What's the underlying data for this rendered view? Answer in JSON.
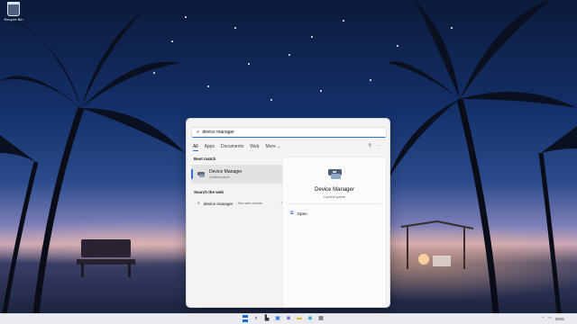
{
  "desktop": {
    "icons": [
      {
        "name": "recycle-bin",
        "label": "Recycle Bin"
      }
    ]
  },
  "search": {
    "query": "device manager",
    "filters": [
      "All",
      "Apps",
      "Documents",
      "Web",
      "More ⌄"
    ],
    "active_filter": "All"
  },
  "best_match": {
    "heading": "Best match",
    "title": "Device Manager",
    "subtitle": "Control panel"
  },
  "web_search": {
    "heading": "Search the web",
    "query": "device manager",
    "suffix": "- See web results"
  },
  "detail": {
    "title": "Device Manager",
    "subtitle": "Control panel",
    "actions": [
      {
        "label": "Open",
        "icon": "open-icon"
      }
    ]
  },
  "taskbar": {
    "apps": [
      "start-icon",
      "search-icon",
      "task-view-icon",
      "widgets-icon",
      "chat-icon",
      "file-explorer-icon",
      "edge-icon",
      "store-icon"
    ],
    "tray_text": "ENG"
  },
  "colors": {
    "accent": "#2f6fd0",
    "panel_bg": "#f3f3f3"
  }
}
